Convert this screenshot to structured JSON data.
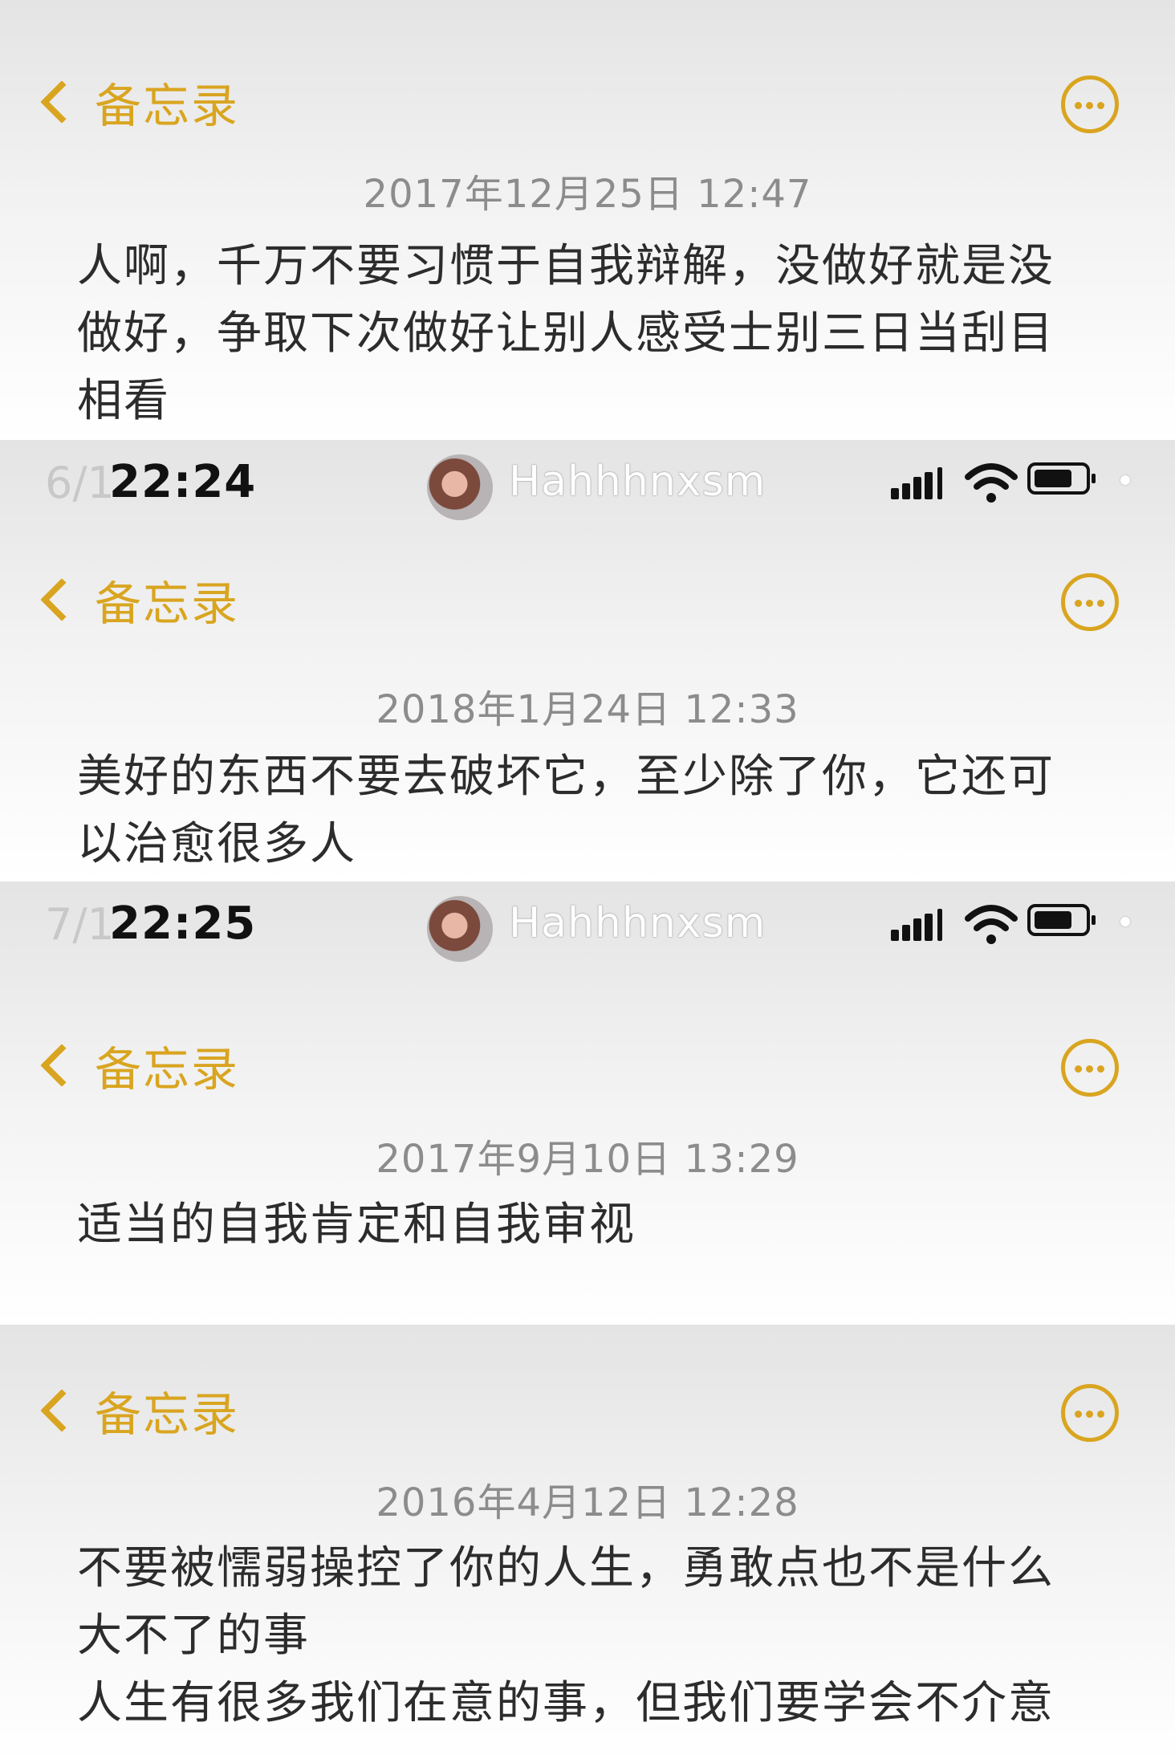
{
  "screens": [
    {
      "status": null,
      "nav": {
        "back_label": "备忘录"
      },
      "date": "2017年12月25日 12:47",
      "lines": [
        "人啊，千万不要习惯于自我辩解，没做好就是没",
        "做好，争取下次做好让别人感受士别三日当刮目",
        "相看"
      ]
    },
    {
      "status": {
        "page": "6/1",
        "time": "22:24",
        "username": "Hahhhnxsm"
      },
      "nav": {
        "back_label": "备忘录"
      },
      "date": "2018年1月24日 12:33",
      "lines": [
        "美好的东西不要去破坏它，至少除了你，它还可",
        "以治愈很多人"
      ]
    },
    {
      "status": {
        "page": "7/1",
        "time": "22:25",
        "username": "Hahhhnxsm"
      },
      "nav": {
        "back_label": "备忘录"
      },
      "date": "2017年9月10日 13:29",
      "lines": [
        "适当的自我肯定和自我审视"
      ]
    },
    {
      "status": null,
      "nav": {
        "back_label": "备忘录"
      },
      "date": "2016年4月12日 12:28",
      "lines": [
        "不要被懦弱操控了你的人生，勇敢点也不是什么",
        "大不了的事",
        "人生有很多我们在意的事，但我们要学会不介意"
      ]
    }
  ],
  "icons": {
    "back": "chevron-left-icon",
    "more": "more-circle-icon",
    "signal": "signal-icon",
    "wifi": "wifi-icon",
    "battery": "battery-icon"
  },
  "colors": {
    "accent": "#d9a520",
    "date": "#8c8c8c",
    "body_text": "#2c2c2c"
  }
}
